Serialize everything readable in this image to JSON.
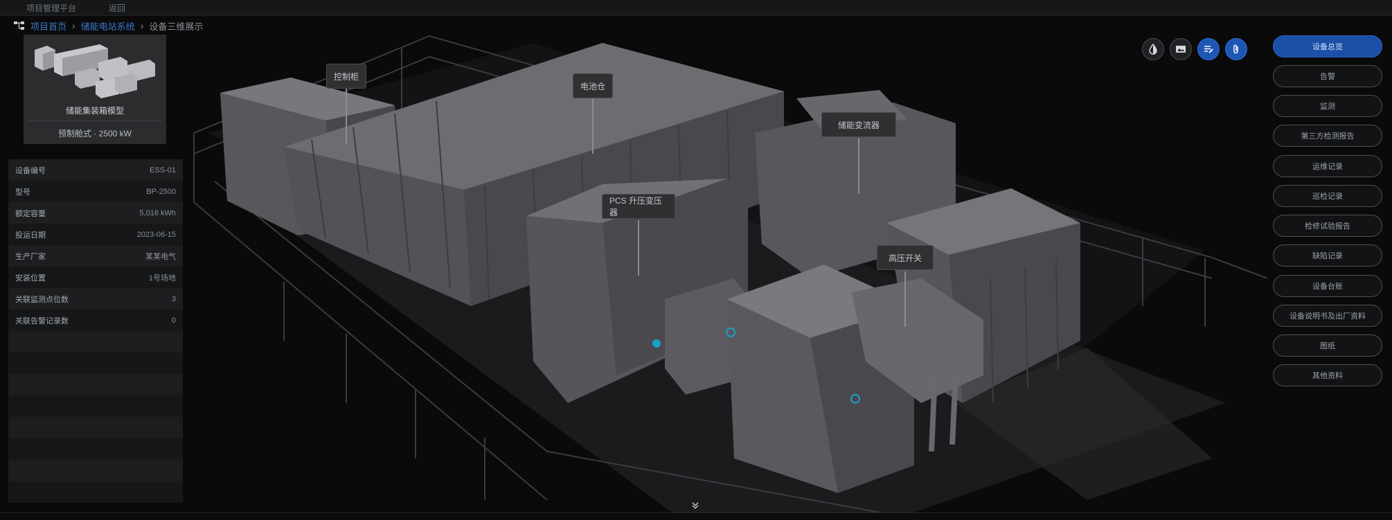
{
  "topbar": {
    "items": [
      "项目管理平台",
      "返回"
    ]
  },
  "breadcrumb": [
    "项目首页",
    "储能电站系统",
    "设备三维展示"
  ],
  "thumbnail": {
    "title": "储能集装箱模型",
    "subtitle": "预制舱式 · 2500 kW"
  },
  "info": [
    {
      "label": "设备编号",
      "value": "ESS-01"
    },
    {
      "label": "型号",
      "value": "BP-2500"
    },
    {
      "label": "额定容量",
      "value": "5,016 kWh"
    },
    {
      "label": "投运日期",
      "value": "2023-06-15"
    },
    {
      "label": "生产厂家",
      "value": "某某电气"
    },
    {
      "label": "安装位置",
      "value": "1号场地"
    },
    {
      "label": "关联监测点位数",
      "value": "3"
    },
    {
      "label": "关联告警记录数",
      "value": "0"
    }
  ],
  "tags": [
    "控制柜",
    "电池仓",
    "储能变流器",
    "PCS 升压变压器",
    "高压开关"
  ],
  "toolbar": {
    "icons": [
      "opacity-icon",
      "image-icon",
      "annotate-icon",
      "attachment-icon"
    ]
  },
  "right_panel": {
    "buttons": [
      "设备总览",
      "告警",
      "监测",
      "第三方检测报告",
      "运维记录",
      "巡检记录",
      "检修试验报告",
      "缺陷记录",
      "设备台账",
      "设备说明书及出厂资料",
      "图纸",
      "其他资料"
    ]
  }
}
